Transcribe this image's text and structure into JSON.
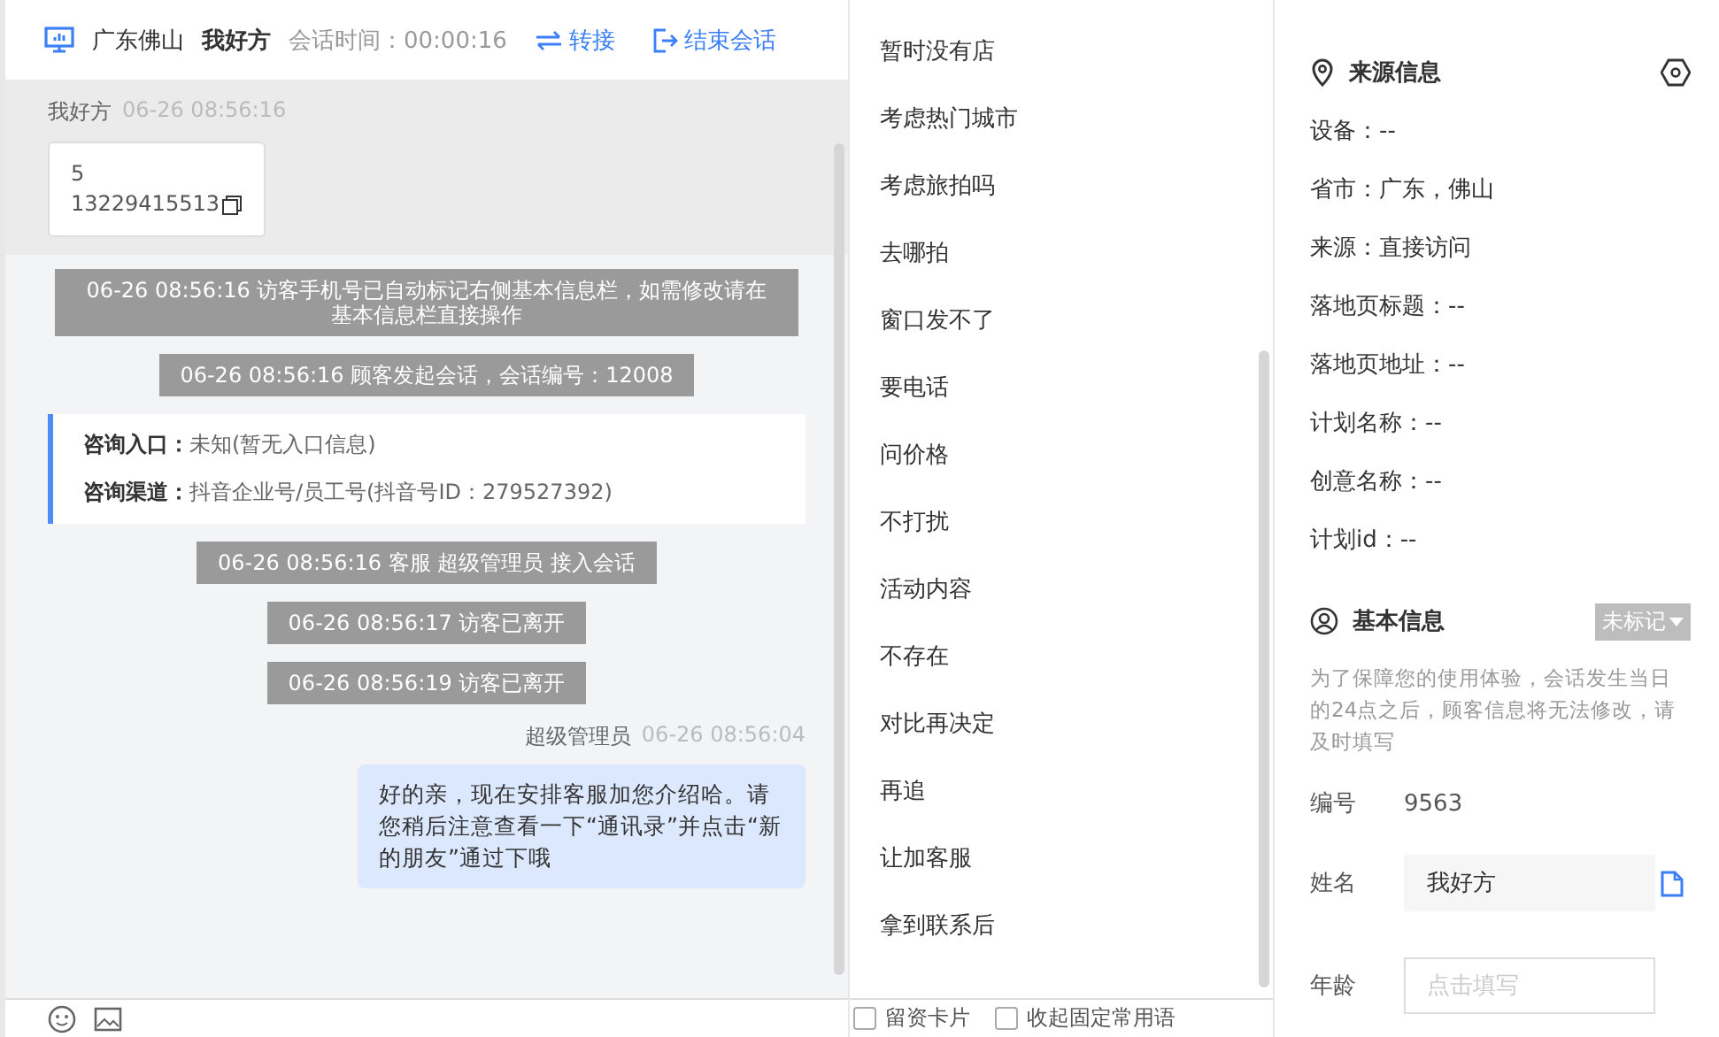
{
  "header": {
    "location": "广东佛山",
    "name": "我好方",
    "timer": "会话时间：00:00:16",
    "transfer": "转接",
    "end": "结束会话"
  },
  "messages": [
    {
      "kind": "visitor",
      "sender": "我好方",
      "time": "06-26 08:56:16",
      "lines": [
        "5",
        "13229415513"
      ]
    },
    {
      "kind": "system",
      "text": "06-26 08:56:16 访客手机号已自动标记右侧基本信息栏，如需修改请在基本信息栏直接操作"
    },
    {
      "kind": "system",
      "text": "06-26 08:56:16 顾客发起会话，会话编号：12008"
    },
    {
      "kind": "entry",
      "rows": [
        {
          "label": "咨询入口：",
          "value": "未知(暂无入口信息)"
        },
        {
          "label": "咨询渠道：",
          "value": "抖音企业号/员工号(抖音号ID：279527392)"
        }
      ]
    },
    {
      "kind": "system",
      "text": "06-26 08:56:16 客服 超级管理员 接入会话"
    },
    {
      "kind": "system",
      "text": "06-26 08:56:17 访客已离开"
    },
    {
      "kind": "system",
      "text": "06-26 08:56:19 访客已离开"
    },
    {
      "kind": "agent",
      "sender": "超级管理员",
      "time": "06-26 08:56:04",
      "text": "好的亲，现在安排客服加您介绍哈。请您稍后注意查看一下“通讯录”并点击“新的朋友”通过下哦"
    }
  ],
  "toolbar": {
    "checkboxes": [
      {
        "label": "留资卡片",
        "checked": false
      },
      {
        "label": "收起固定常用语",
        "checked": false
      }
    ]
  },
  "quick_replies": [
    "暂时没有店",
    "考虑热门城市",
    "考虑旅拍吗",
    "去哪拍",
    "窗口发不了",
    "要电话",
    "问价格",
    "不打扰",
    "活动内容",
    "不存在",
    "对比再决定",
    "再追",
    "让加客服",
    "拿到联系后"
  ],
  "source_info": {
    "title": "来源信息",
    "items": [
      "设备：--",
      "省市：广东，佛山",
      "来源：直接访问",
      "落地页标题：--",
      "落地页地址：--",
      "计划名称：--",
      "创意名称：--",
      "计划id：--"
    ]
  },
  "basic_info": {
    "title": "基本信息",
    "tag": "未标记",
    "notice": "为了保障您的使用体验，会话发生当日的24点之后，顾客信息将无法修改，请及时填写",
    "fields": [
      {
        "kind": "text",
        "label": "编号",
        "value": "9563"
      },
      {
        "kind": "input",
        "label": "姓名",
        "value": "我好方"
      },
      {
        "kind": "input",
        "label": "年龄",
        "placeholder": "点击填写"
      }
    ]
  }
}
